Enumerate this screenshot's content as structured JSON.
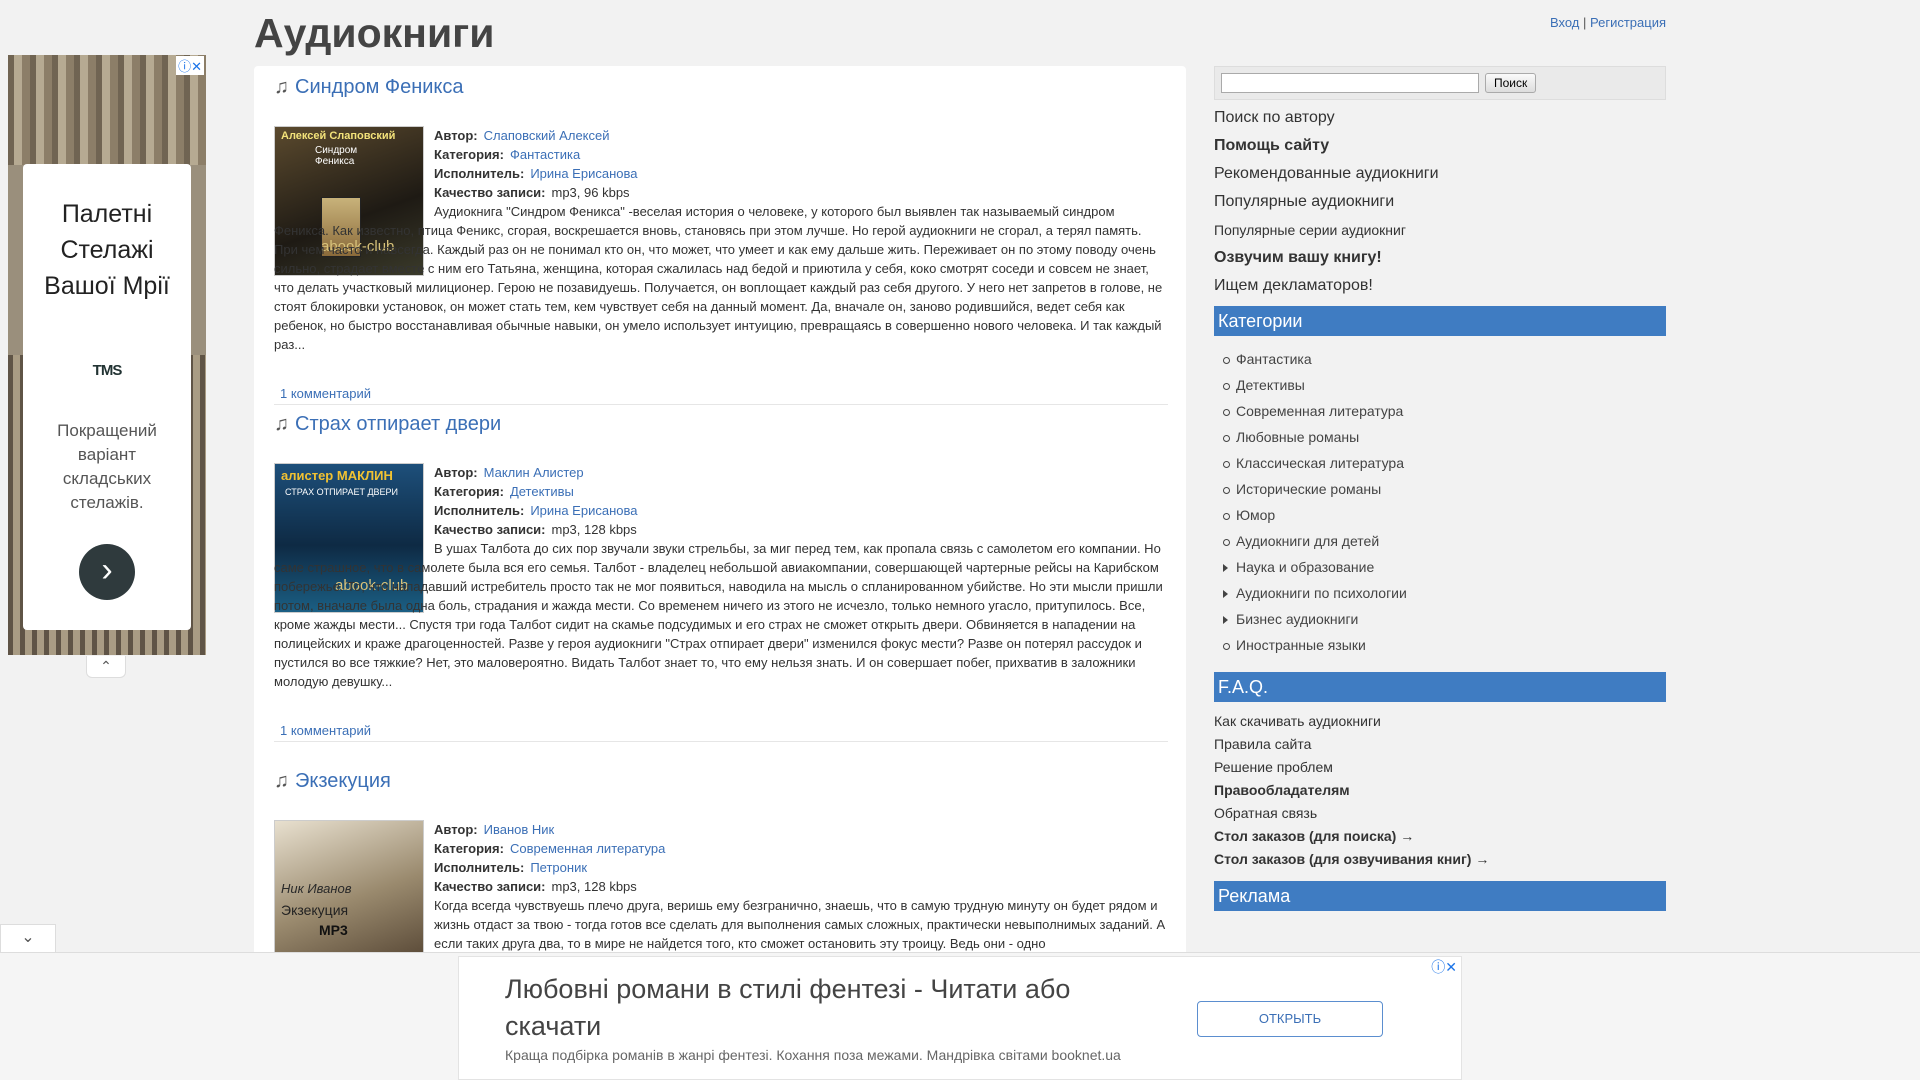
{
  "header": {
    "title": "Аудиокниги",
    "login": "Вход",
    "separator": "|",
    "register": "Регистрация"
  },
  "left_ad": {
    "badges": "ⓘ✕",
    "headline": "Палетні Стелажі Вашої Мрії",
    "logo": "TMS",
    "body": "Покращений варіант складських стелажів.",
    "go": "›",
    "collapse": "⌃"
  },
  "posts": [
    {
      "title": "Синдром Феникса",
      "author_label": "Автор:",
      "author": "Слаповский Алексей",
      "category_label": "Категория:",
      "category": "Фантастика",
      "reader_label": "Исполнитель:",
      "reader": "Ирина Ерисанова",
      "quality_label": "Качество записи:",
      "quality": "mp3, 96 kbps",
      "description": "Аудиокнига \"Синдром Феникса\" -веселая история о человеке, у которого был выявлен так называемый синдром Феникса. Как известно, птица Феникс, сгорая, воскрешается вновь, становясь при этом лучше. Но герой аудиокниги не сгорал, а терял память. При чем часто и навсегда. Каждый раз он не понимал кто он, что может, что умеет и как ему дальше жить. Переживает он по этому поводу очень сильно, страдает вместе с ним его Татьяна, женщина, которая сжалилась над бедой и приютила у себя, коко смотрят соседи и совсем не знает, что делать участковый милиционер. Герою не позавидуешь. Получается, он воплощает каждый раз себя другого. У него нет запретов в голове, не стоят блокировки установок, он может стать тем, кем чувствует себя на данный момент. Да, вначале он, заново родившийся, ведет себя как ребенок, но быстро восстанавливая обычные навыки, он умело использует интуицию, превращаясь в совершенно нового человека. И так каждый раз...",
      "comments": "1 комментарий",
      "cover_text_1": "Алексей Слаповский",
      "cover_text_2": "Синдром Феникса",
      "cover_text_3": "abook-club"
    },
    {
      "title": "Страх отпирает двери",
      "author_label": "Автор:",
      "author": "Маклин Алистер",
      "category_label": "Категория:",
      "category": "Детективы",
      "reader_label": "Исполнитель:",
      "reader": "Ирина Ерисанова",
      "quality_label": "Качество записи:",
      "quality": "mp3, 128 kbps",
      "description": "В ушах Талбота до сих пор звучали звуки стрельбы, за миг перед тем, как пропала связь с самолетом его компании. Но саме страшное, что в самолете была вся его семья. Талбот - владелец небольшой авиакомпании, совершающей чартерные рейсы на Карибском побережье. То, что нападавший истребитель просто так не мог появиться, наводила на мысль о спланированном убийстве. Но эти мысли пришли потом, вначале была одна боль, страдания и жажда мести. Со временем ничего из этого не исчезло, только немного угасло, притупилось. Все, кроме жажды мести... Спустя три года Талбот сидит на скамье подсудимых и его страх не сможет открыть двери. Обвиняется в нападении на полицейских и краже драгоценностей. Разве у героя аудиокниги \"Страх отпирает двери\" изменился фокус мести? Разве он потерял рассудок и пустился во все тяжкие? Нет, это маловероятно. Видать Талбот знает то, что ему нельзя знать. И он совершает побег, прихватив в заложники молодую девушку...",
      "comments": "1 комментарий",
      "cover_text_1": "алистер МАКЛИН",
      "cover_text_2": "СТРАХ ОТПИРАЕТ ДВЕРИ",
      "cover_text_3": "abook-club"
    },
    {
      "title": "Экзекуция",
      "author_label": "Автор:",
      "author": "Иванов Ник",
      "category_label": "Категория:",
      "category": "Современная литература",
      "reader_label": "Исполнитель:",
      "reader": "Петроник",
      "quality_label": "Качество записи:",
      "quality": "mp3, 128 kbps",
      "description": "Когда всегда чувствуешь плечо друга, веришь ему безгранично, знаешь, что в самую трудную минуту он будет рядом и жизнь отдаст за твою - тогда готов все сделать для выполнения самых сложных, практически невыполнимых заданий. А если таких друга два, то в мире не найдется того, кто сможет остановить эту троицу. Ведь они - одно",
      "comments": "",
      "cover_text_1": "Ник Иванов",
      "cover_text_2": "Экзекуция",
      "cover_text_3": "MP3"
    }
  ],
  "sidebar": {
    "search_button": "Поиск",
    "search_value": "",
    "links": [
      {
        "label": "Поиск по автору",
        "bold": false,
        "small": false
      },
      {
        "label": "Помощь сайту",
        "bold": true,
        "small": false
      },
      {
        "label": "Рекомендованные аудиокниги",
        "bold": false,
        "small": false
      },
      {
        "label": "Популярные аудиокниги",
        "bold": false,
        "small": false
      },
      {
        "label": "Популярные серии аудиокниг",
        "bold": false,
        "small": true
      },
      {
        "label": "Озвучим вашу книгу!",
        "bold": true,
        "small": false
      },
      {
        "label": "Ищем декламаторов!",
        "bold": false,
        "small": false
      }
    ],
    "categories_title": "Категории",
    "categories": [
      {
        "label": "Фантастика",
        "tri": false
      },
      {
        "label": "Детективы",
        "tri": false
      },
      {
        "label": "Современная литература",
        "tri": false
      },
      {
        "label": "Любовные романы",
        "tri": false
      },
      {
        "label": "Классическая литература",
        "tri": false
      },
      {
        "label": "Исторические романы",
        "tri": false
      },
      {
        "label": "Юмор",
        "tri": false
      },
      {
        "label": "Аудиокниги для детей",
        "tri": false
      },
      {
        "label": "Наука и образование",
        "tri": true
      },
      {
        "label": "Аудиокниги по психологии",
        "tri": true
      },
      {
        "label": "Бизнес аудиокниги",
        "tri": true
      },
      {
        "label": "Иностранные языки",
        "tri": false
      }
    ],
    "faq_title": "F.A.Q.",
    "faq": [
      {
        "label": "Как скачивать аудиокниги",
        "bold": false
      },
      {
        "label": "Правила сайта",
        "bold": false
      },
      {
        "label": "Решение проблем",
        "bold": false
      },
      {
        "label": "Правообладателям",
        "bold": true
      },
      {
        "label": "Обратная связь",
        "bold": false
      },
      {
        "label": "Стол заказов (для поиска) →",
        "bold": true
      },
      {
        "label": "Стол заказов (для озвучивания книг) →",
        "bold": true
      }
    ],
    "ad_title": "Реклама"
  },
  "bottom_ad": {
    "title": "Любовні романи в стилі фентезі - Читати або скачати",
    "subtitle": "Краща подбірка романів в жанрі фентезі. Кохання поза межами. Мандрівка світами booknet.ua",
    "button": "ОТКРЫТЬ",
    "badges": "ⓘ✕",
    "collapse": "⌄"
  },
  "icons": {
    "music-note": "♫"
  }
}
